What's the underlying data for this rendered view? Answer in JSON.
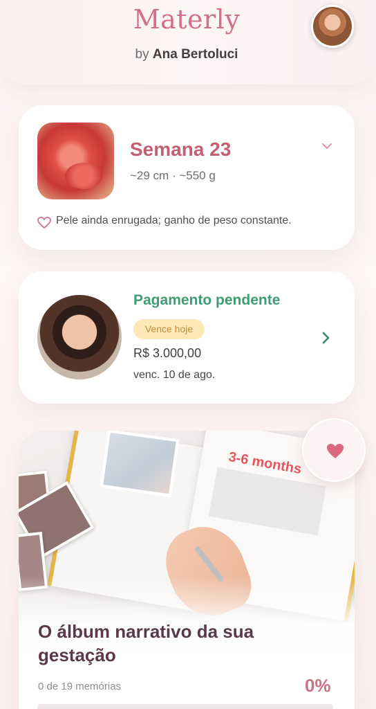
{
  "header": {
    "app_name": "Materly",
    "by_prefix": "by",
    "author": "Ana Bertoluci",
    "avatar_icon": "user-avatar"
  },
  "week_card": {
    "title": "Semana 23",
    "size": "~29 cm · ~550 g",
    "note": "Pele ainda enrugada; ganho de peso constante.",
    "image_icon": "embryo-image",
    "expand_icon": "chevron-down-icon"
  },
  "payment_card": {
    "title": "Pagamento pendente",
    "badge": "Vence hoje",
    "amount": "R$ 3.000,00",
    "due": "venc. 10 de ago.",
    "avatar_icon": "professional-avatar",
    "arrow_icon": "chevron-right-icon"
  },
  "album_card": {
    "title": "O álbum narrativo da sua gestação",
    "memories": "0 de 19 memórias",
    "percent": "0%",
    "progress_fraction": 0,
    "photo_text": "3-6 months"
  },
  "favorite": {
    "icon": "heart-icon"
  },
  "colors": {
    "accent_pink": "#c87487",
    "title_rose": "#c2606f",
    "success_green": "#3e9d73",
    "badge_bg": "#fde8b8",
    "badge_text": "#c48e33"
  }
}
